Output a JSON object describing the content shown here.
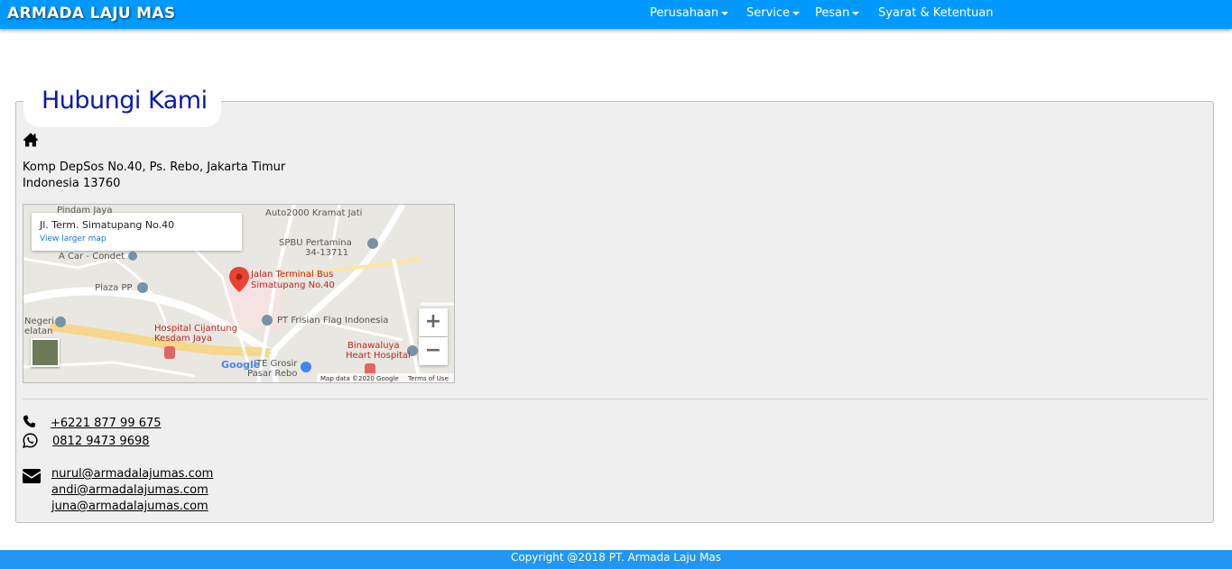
{
  "brand": "ARMADA LAJU MAS",
  "nav": {
    "perusahaan": "Perusahaan",
    "service": "Service",
    "pesan": "Pesan",
    "syarat": "Syarat & Ketentuan"
  },
  "contact": {
    "title": "Hubungi Kami",
    "address_line1": "Komp DepSos No.40, Ps. Rebo, Jakarta Timur",
    "address_line2": "Indonesia 13760",
    "phone": "+6221 877 99 675",
    "whatsapp": "0812 9473 9698",
    "emails": [
      "nurul@armadalajumas.com",
      "andi@armadalajumas.com",
      "juna@armadalajumas.com"
    ]
  },
  "map": {
    "card_title": "Jl. Term. Simatupang No.40",
    "card_link": "View larger map",
    "pin_label_1": "Jalan Terminal Bus",
    "pin_label_2": "Simatupang No.40",
    "labels": {
      "pindam": "Pindam Jaya",
      "auto2000": "Auto2000 Kramat Jati",
      "spbu1": "SPBU Pertamina",
      "spbu2": "34-13711",
      "acar": "A Car - Condet",
      "plaza": "Plaza PP",
      "frisian": "PT Frisian Flag Indonesia",
      "negeri": "Negeri",
      "selatan": "elatan",
      "hospital1": "Hospital Cijantung",
      "hospital2": "Kesdam Jaya",
      "binawaluya1": "Binawaluya",
      "binawaluya2": "Heart Hospital",
      "grosir1": "ITE Grosir",
      "grosir2": "Pasar Rebo"
    },
    "google": "Google",
    "attribution": "Map data ©2020 Google",
    "terms": "Terms of Use",
    "zoom_in": "+",
    "zoom_out": "−"
  },
  "footer": "Copyright @2018 PT. Armada Laju Mas",
  "colors": {
    "navbar": "#0099ff",
    "footer": "#2196f3",
    "title": "#0a18b0"
  }
}
